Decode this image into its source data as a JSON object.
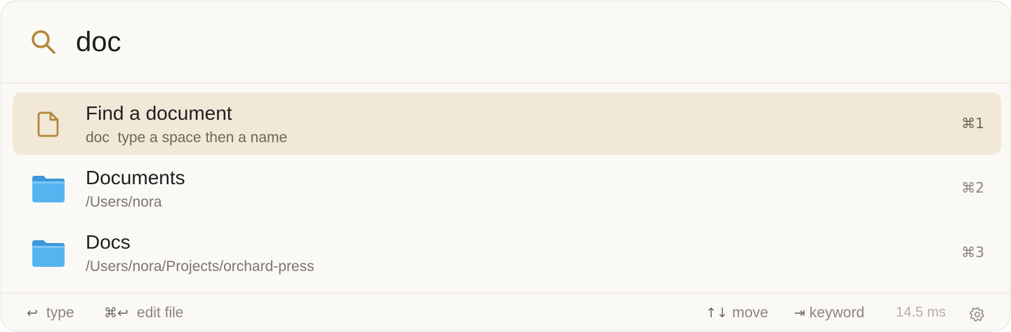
{
  "search": {
    "query": "doc",
    "icon": "search-icon"
  },
  "results": [
    {
      "title": "Find a document",
      "keyword": "doc",
      "subtitle": "type a space then a name",
      "shortcut": "⌘1",
      "icon": "document-icon",
      "selected": true
    },
    {
      "title": "Documents",
      "subtitle": "/Users/nora",
      "shortcut": "⌘2",
      "icon": "folder-icon",
      "selected": false
    },
    {
      "title": "Docs",
      "subtitle": "/Users/nora/Projects/orchard-press",
      "shortcut": "⌘3",
      "icon": "folder-icon",
      "selected": false
    }
  ],
  "footer": {
    "hints": [
      {
        "glyph": "↩",
        "label": "type"
      },
      {
        "glyph": "⌘↩",
        "label": "edit file"
      },
      {
        "glyph": "↑↓",
        "label": "move"
      },
      {
        "glyph": "⇥",
        "label": "keyword"
      }
    ],
    "timing": "14.5 ms",
    "settings_icon": "gear-icon"
  },
  "colors": {
    "accent": "#b5873a",
    "selected_row": "#f2e8d8",
    "background": "#fbf9f5",
    "folder_blue": "#4aa8ec"
  }
}
